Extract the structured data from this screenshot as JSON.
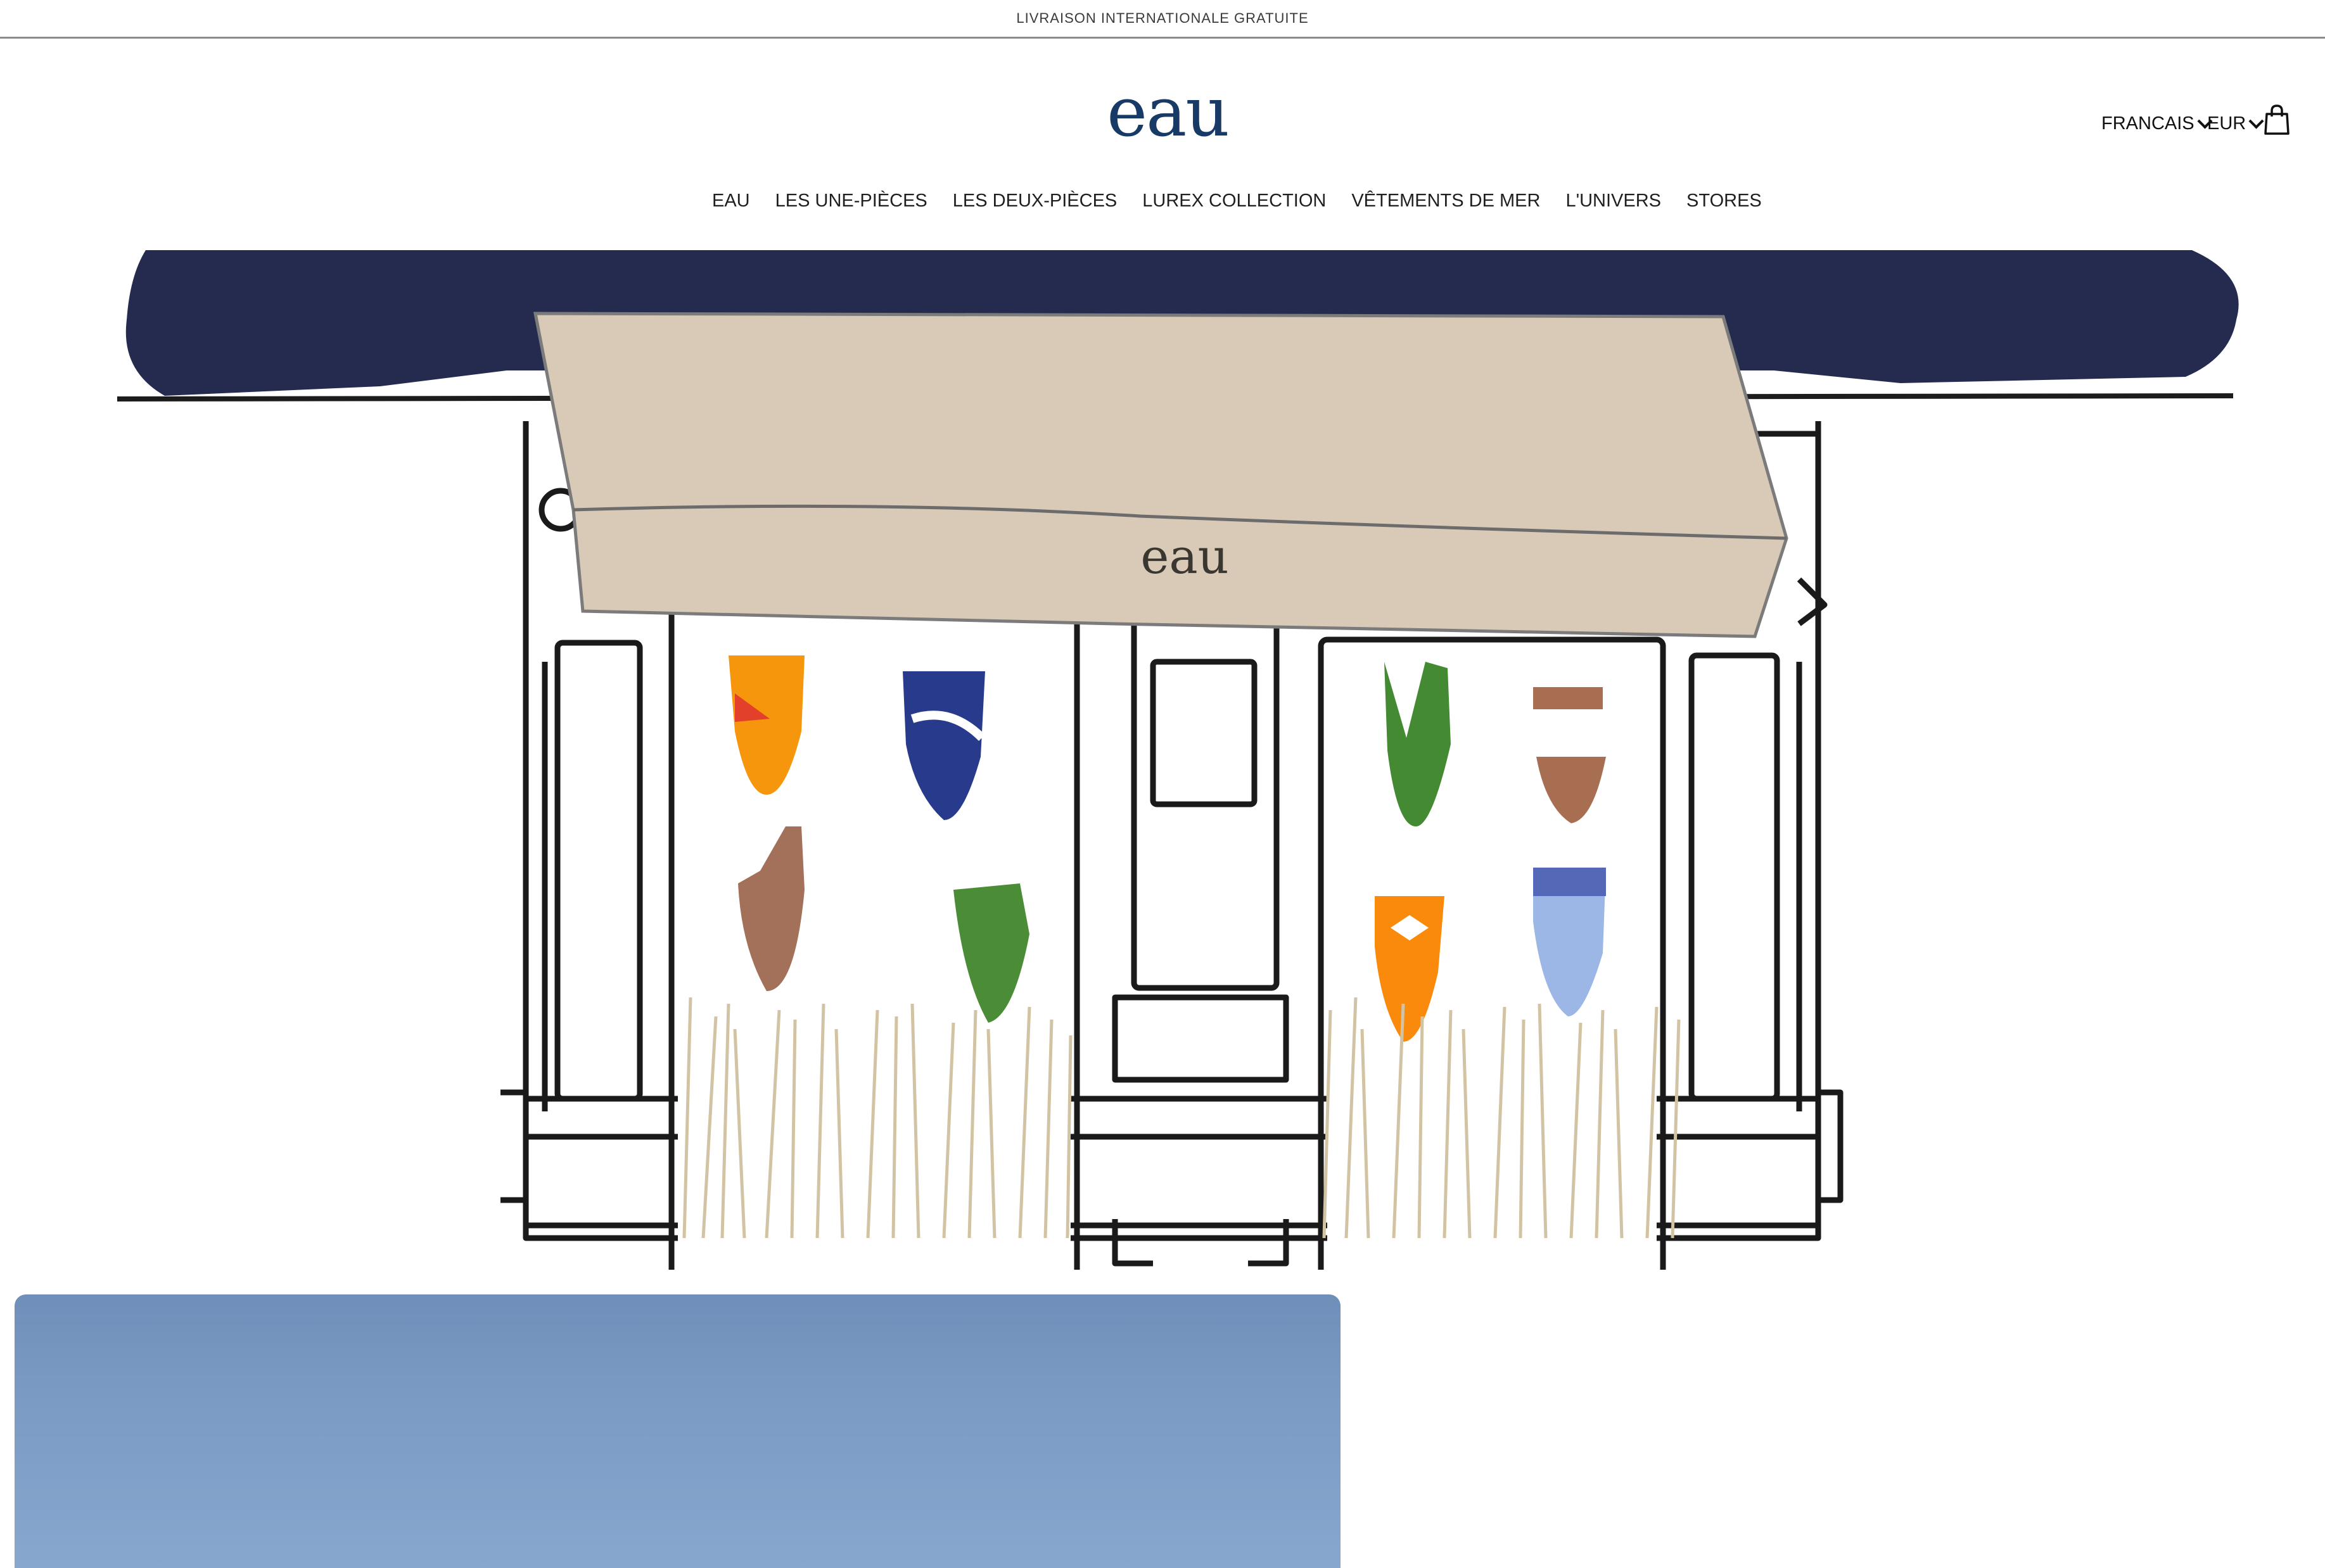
{
  "announcement": "LIVRAISON INTERNATIONALE GRATUITE",
  "logo": "eau",
  "header": {
    "language": "FRANCAIS",
    "currency": "EUR"
  },
  "nav": [
    "EAU",
    "LES UNE-PIÈCES",
    "LES DEUX-PIÈCES",
    "LUREX COLLECTION",
    "VÊTEMENTS DE MER",
    "L'UNIVERS",
    "STORES"
  ],
  "hero": {
    "awning_sign": "eau"
  },
  "colors": {
    "brand": "#183a66",
    "awning": "#d9cab8",
    "sky": "#252b4f",
    "panel": "#7c9bc4"
  },
  "icons": [
    "chevron-down-icon",
    "shopping-bag-icon"
  ]
}
